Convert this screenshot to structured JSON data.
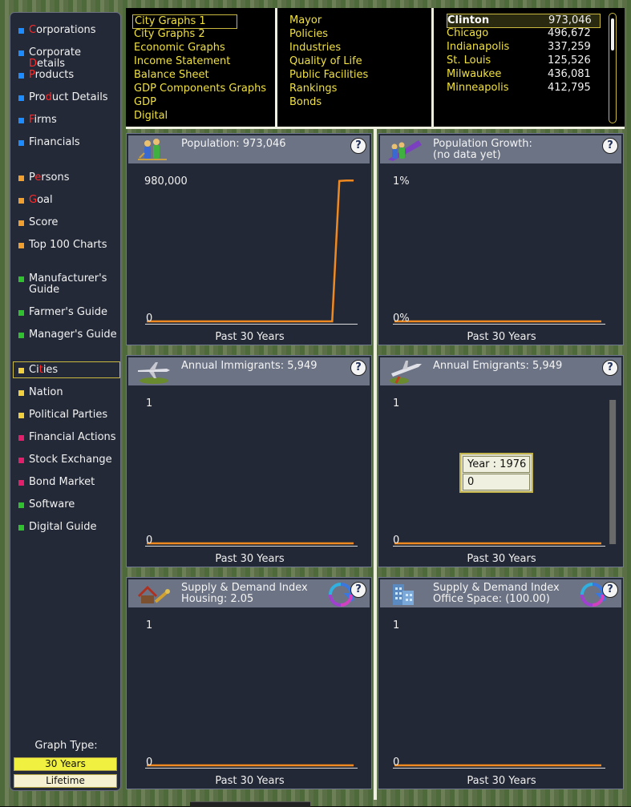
{
  "sidebar": {
    "groups": [
      {
        "color": "#1e8cff",
        "items": [
          {
            "pre": "",
            "hl": "C",
            "post": "orporations"
          },
          {
            "pre": "Corporate ",
            "hl": "D",
            "post": "etails"
          },
          {
            "pre": "",
            "hl": "P",
            "post": "roducts"
          },
          {
            "pre": "Pro",
            "hl": "d",
            "post": "uct Details"
          },
          {
            "pre": "",
            "hl": "F",
            "post": "irms"
          },
          {
            "pre": "Financials",
            "hl": "",
            "post": ""
          }
        ]
      },
      {
        "color": "#f0a030",
        "items": [
          {
            "pre": "P",
            "hl": "e",
            "post": "rsons"
          },
          {
            "pre": "",
            "hl": "G",
            "post": "oal"
          },
          {
            "pre": "Score",
            "hl": "",
            "post": ""
          },
          {
            "pre": "Top 100 Charts",
            "hl": "",
            "post": ""
          }
        ]
      },
      {
        "color": "#30c030",
        "items": [
          {
            "pre": "Manufacturer's Guide",
            "hl": "",
            "post": ""
          },
          {
            "pre": "Farmer's Guide",
            "hl": "",
            "post": ""
          },
          {
            "pre": "Manager's Guide",
            "hl": "",
            "post": ""
          }
        ]
      },
      {
        "color": "#f0d040",
        "items": [
          {
            "pre": "Ci",
            "hl": "t",
            "post": "ies"
          },
          {
            "pre": "Nation",
            "hl": "",
            "post": ""
          },
          {
            "pre": "Political Parties",
            "hl": "",
            "post": ""
          }
        ]
      },
      {
        "color": "#e0206a",
        "items": [
          {
            "pre": "Financial Actions",
            "hl": "",
            "post": ""
          },
          {
            "pre": "Stock Exchange",
            "hl": "",
            "post": ""
          },
          {
            "pre": "Bond Market",
            "hl": "",
            "post": ""
          }
        ]
      },
      {
        "color": "#30c030",
        "items": [
          {
            "pre": "Software",
            "hl": "",
            "post": ""
          },
          {
            "pre": "Digital Guide",
            "hl": "",
            "post": ""
          }
        ]
      }
    ],
    "graph_type_label": "Graph Type:",
    "graph_type_options": [
      "30 Years",
      "Lifetime"
    ]
  },
  "menu": {
    "col1": [
      "City Graphs 1",
      "City Graphs 2",
      "Economic Graphs",
      "Income Statement",
      "Balance Sheet",
      "GDP Components Graphs",
      "GDP",
      "Digital"
    ],
    "col2": [
      "Mayor",
      "Policies",
      "Industries",
      "Quality of Life",
      "Public Facilities",
      "Rankings",
      "Bonds"
    ],
    "cities": [
      {
        "name": "Clinton",
        "pop": "973,046"
      },
      {
        "name": "Chicago",
        "pop": "496,672"
      },
      {
        "name": "Indianapolis",
        "pop": "337,259"
      },
      {
        "name": "St. Louis",
        "pop": "125,526"
      },
      {
        "name": "Milwaukee",
        "pop": "436,081"
      },
      {
        "name": "Minneapolis",
        "pop": "412,795"
      }
    ]
  },
  "panels": [
    {
      "title": "Population: 973,046",
      "icon": "population-icon",
      "ymax": "980,000",
      "ymin": "0",
      "xlabel": "Past 30 Years"
    },
    {
      "title": "Population Growth:\n(no data yet)",
      "icon": "population-growth-icon",
      "ymax": "1%",
      "ymin": "0%",
      "xlabel": "Past 30 Years"
    },
    {
      "title": "Annual Immigrants: 5,949",
      "icon": "immigrant-plane-icon",
      "ymax": "1",
      "ymin": "0",
      "xlabel": "Past 30 Years"
    },
    {
      "title": "Annual Emigrants: 5,949",
      "icon": "emigrant-plane-icon",
      "ymax": "1",
      "ymin": "0",
      "xlabel": "Past 30 Years"
    },
    {
      "title": "Supply & Demand Index\nHousing: 2.05",
      "icon": "housing-tools-icon",
      "ymax": "1",
      "ymin": "0",
      "xlabel": "Past 30 Years"
    },
    {
      "title": "Supply & Demand Index\nOffice Space: (100.00)",
      "icon": "office-building-icon",
      "ymax": "1",
      "ymin": "0",
      "xlabel": "Past 30 Years"
    }
  ],
  "help_label": "?",
  "tooltip": {
    "line1": "Year : 1976",
    "line2": "0"
  },
  "chart_data": [
    {
      "type": "line",
      "title": "Population: 973,046",
      "xlabel": "Past 30 Years",
      "ylim": [
        0,
        980000
      ],
      "x": [
        1,
        27,
        28,
        29,
        30
      ],
      "series": [
        {
          "values": [
            0,
            0,
            970000,
            973046,
            973046
          ]
        }
      ]
    },
    {
      "type": "line",
      "title": "Population Growth: (no data yet)",
      "xlabel": "Past 30 Years",
      "ylim": [
        "0%",
        "1%"
      ],
      "x": [
        1,
        30
      ],
      "series": [
        {
          "values": [
            0,
            0
          ]
        }
      ]
    },
    {
      "type": "line",
      "title": "Annual Immigrants: 5,949",
      "xlabel": "Past 30 Years",
      "ylim": [
        0,
        1
      ],
      "x": [
        1,
        30
      ],
      "series": [
        {
          "values": [
            0,
            0
          ]
        }
      ]
    },
    {
      "type": "line",
      "title": "Annual Emigrants: 5,949",
      "xlabel": "Past 30 Years",
      "ylim": [
        0,
        1
      ],
      "x": [
        1,
        30
      ],
      "series": [
        {
          "values": [
            0,
            0
          ]
        }
      ]
    },
    {
      "type": "line",
      "title": "Supply & Demand Index Housing: 2.05",
      "xlabel": "Past 30 Years",
      "ylim": [
        0,
        1
      ],
      "x": [
        1,
        30
      ],
      "series": [
        {
          "values": [
            0,
            0
          ]
        }
      ]
    },
    {
      "type": "line",
      "title": "Supply & Demand Index Office Space: (100.00)",
      "xlabel": "Past 30 Years",
      "ylim": [
        0,
        1
      ],
      "x": [
        1,
        30
      ],
      "series": [
        {
          "values": [
            0,
            0
          ]
        }
      ]
    }
  ],
  "colors": {
    "line": "#f08a20",
    "menu_text": "#f0e040",
    "panel_bg": "#232836",
    "header_bg": "#6c7384"
  }
}
